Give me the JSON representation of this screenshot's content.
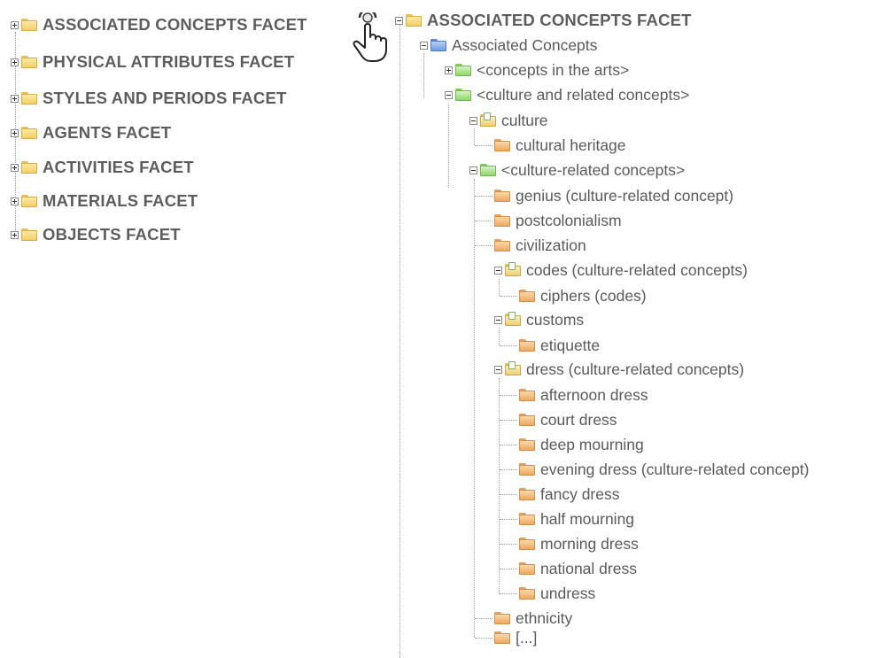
{
  "left_tree": {
    "items": [
      {
        "label": "ASSOCIATED CONCEPTS FACET"
      },
      {
        "label": "PHYSICAL ATTRIBUTES FACET"
      },
      {
        "label": "STYLES AND PERIODS FACET"
      },
      {
        "label": "AGENTS FACET"
      },
      {
        "label": "ACTIVITIES FACET"
      },
      {
        "label": "MATERIALS FACET"
      },
      {
        "label": "OBJECTS FACET"
      }
    ]
  },
  "right_tree": {
    "root": "ASSOCIATED CONCEPTS FACET",
    "associated": "Associated Concepts",
    "arts": "<concepts in the arts>",
    "culture_group": "<culture and related concepts>",
    "culture": "culture",
    "cultural_heritage": "cultural heritage",
    "culture_related": "<culture-related concepts>",
    "genius": "genius (culture-related concept)",
    "postcolonialism": "postcolonialism",
    "civilization": "civilization",
    "codes": "codes (culture-related concepts)",
    "ciphers": "ciphers (codes)",
    "customs": "customs",
    "etiquette": "etiquette",
    "dress": "dress (culture-related concepts)",
    "dress_items": [
      "afternoon dress",
      "court dress",
      "deep mourning",
      "evening dress (culture-related concept)",
      "fancy dress",
      "half mourning",
      "morning dress",
      "national dress",
      "undress"
    ],
    "ethnicity": "ethnicity",
    "more": "[...]"
  },
  "icons": {
    "folder": "folder-icon",
    "cursor": "hand-cursor-icon",
    "expand": "plus-expander-icon",
    "collapse": "minus-expander-icon"
  }
}
